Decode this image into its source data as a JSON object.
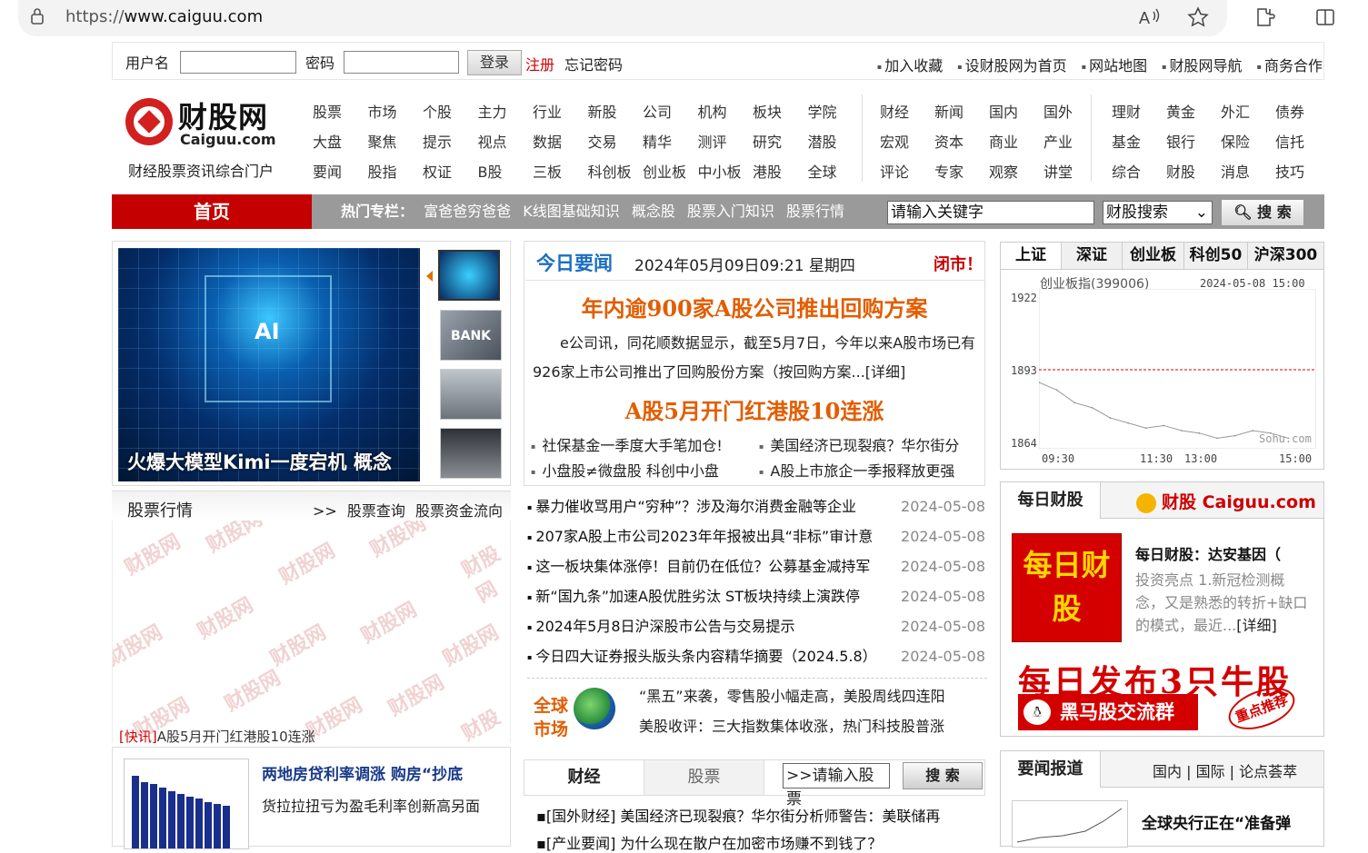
{
  "browser": {
    "url_prefix": "https://",
    "url_host": "www.caiguu.com",
    "icons": [
      "lock-icon",
      "read-aloud-icon",
      "favorite-icon",
      "extensions-icon",
      "split-screen-icon"
    ]
  },
  "login": {
    "username_label": "用户名",
    "password_label": "密码",
    "login_button": "登录",
    "register": "注册",
    "forgot": "忘记密码"
  },
  "toplinks": [
    "加入收藏",
    "设财股网为首页",
    "网站地图",
    "财股网导航",
    "商务合作"
  ],
  "logo": {
    "title": "财股网",
    "domain": "Caiguu.com",
    "subtitle": "财经股票资讯综合门户"
  },
  "nav": {
    "group1": [
      [
        "股票",
        "市场",
        "个股",
        "主力",
        "行业",
        "新股",
        "公司",
        "机构",
        "板块",
        "学院"
      ],
      [
        "大盘",
        "聚焦",
        "提示",
        "视点",
        "数据",
        "交易",
        "精华",
        "测评",
        "研究",
        "潜股"
      ],
      [
        "要闻",
        "股指",
        "权证",
        "B股",
        "三板",
        "科创板",
        "创业板",
        "中小板",
        "港股",
        "全球"
      ]
    ],
    "group2": [
      [
        "财经",
        "新闻",
        "国内",
        "国外"
      ],
      [
        "宏观",
        "资本",
        "商业",
        "产业"
      ],
      [
        "评论",
        "专家",
        "观察",
        "讲堂"
      ]
    ],
    "group3": [
      [
        "理财",
        "黄金",
        "外汇",
        "债券"
      ],
      [
        "基金",
        "银行",
        "保险",
        "信托"
      ],
      [
        "综合",
        "财股",
        "消息",
        "技巧"
      ]
    ]
  },
  "bar": {
    "home": "首页",
    "hot_label": "热门专栏：",
    "hot_links": [
      "富爸爸穷爸爸",
      "K线图基础知识",
      "概念股",
      "股票入门知识",
      "股票行情"
    ],
    "search_placeholder": "请输入关键字",
    "search_select": "财股搜索",
    "search_button": "搜 索"
  },
  "slideshow": {
    "caption": "火爆大模型Kimi一度宕机 概念",
    "badge": "AI",
    "thumb_label": "BANK"
  },
  "stock_quote": {
    "title": "股票行情",
    "arrow": ">>",
    "links": [
      "股票查询",
      "股票资金流向"
    ],
    "watermark": "财股网",
    "watermark_domain": "Caiguu.com",
    "ticker_tag": "[快讯]",
    "ticker_text": "A股5月开门红港股10连涨"
  },
  "house": {
    "title": "两地房贷利率调涨 购房“抄底",
    "desc": "货拉拉扭亏为盈毛利率创新高另面"
  },
  "today": {
    "title": "今日要闻",
    "date": "2024年05月09日09:21 星期四",
    "status": "闭市！",
    "headline1": "年内逾900家A股公司推出回购方案",
    "summary": "e公司讯，同花顺数据显示，截至5月7日，今年以来A股市场已有926家上市公司推出了回购股份方案（按回购方案...[详细]",
    "headline2": "A股5月开门红港股10连涨",
    "subs": [
      "社保基金一季度大手笔加仓!",
      "美国经济已现裂痕？华尔街分",
      "小盘股≠微盘股 科创中小盘",
      "A股上市旅企一季报释放更强"
    ],
    "list": [
      {
        "t": "暴力催收骂用户“穷种”？涉及海尔消费金融等企业",
        "d": "2024-05-08"
      },
      {
        "t": "207家A股上市公司2023年年报被出具“非标”审计意",
        "d": "2024-05-08"
      },
      {
        "t": "这一板块集体涨停！目前仍在低位？公募基金减持军",
        "d": "2024-05-08"
      },
      {
        "t": "新“国九条”加速A股优胜劣汰 ST板块持续上演跌停",
        "d": "2024-05-08"
      },
      {
        "t": "2024年5月8日沪深股市公告与交易提示",
        "d": "2024-05-08"
      },
      {
        "t": "今日四大证券报头版头条内容精华摘要（2024.5.8）",
        "d": "2024-05-08"
      }
    ]
  },
  "global": {
    "label1": "全球",
    "label2": "市场",
    "text": "“黑五”来袭，零售股小幅走高，美股周线四连阳",
    "text2": "美股收评：三大指数集体收涨，热门科技股普涨"
  },
  "tabs2": {
    "tab1": "财经",
    "tab2": "股票",
    "input": ">>请输入股票",
    "button": "搜 索",
    "items": [
      "[国外财经] 美国经济已现裂痕？华尔街分析师警告：美联储再",
      "[产业要闻] 为什么现在散户在加密市场赚不到钱了？"
    ]
  },
  "index": {
    "tabs": [
      "上证",
      "深证",
      "创业板",
      "科创50",
      "沪深300"
    ],
    "name": "创业板指(399006)",
    "datetime": "2024-05-08 15:00",
    "y_labels": [
      "1922",
      "1893",
      "1864"
    ],
    "x_labels": [
      "09:30",
      "11:30",
      "13:00",
      "15:00"
    ],
    "source": "Sohu.com"
  },
  "daily": {
    "tab": "每日财股",
    "logo": "财股 Caiguu.com",
    "img_text": "每日财股",
    "title": "每日财股：达安基因（",
    "desc": "投资亮点 1.新冠检测概念，又是熟悉的转折+缺口的模式，最近...",
    "more": "[详细]",
    "ad_title": "每日发布3只牛股",
    "ad_group": "黑马股交流群",
    "stamp": "重点推荐"
  },
  "report": {
    "tab": "要闻报道",
    "links": "国内 | 国际 | 论点荟萃",
    "title": "全球央行正在“准备弹"
  },
  "chart_data": {
    "type": "line",
    "title": "创业板指(399006)",
    "ylim": [
      1864,
      1922
    ],
    "ref_line": 1893,
    "x": [
      "09:30",
      "11:30",
      "13:00",
      "15:00"
    ],
    "values": [
      1888,
      1885,
      1880,
      1878,
      1874,
      1872,
      1870,
      1871,
      1869,
      1868,
      1866,
      1867,
      1869,
      1868,
      1866
    ]
  },
  "house_chart": {
    "values": [
      140,
      128,
      124,
      118,
      110,
      105,
      100,
      96,
      90,
      86,
      82
    ]
  }
}
